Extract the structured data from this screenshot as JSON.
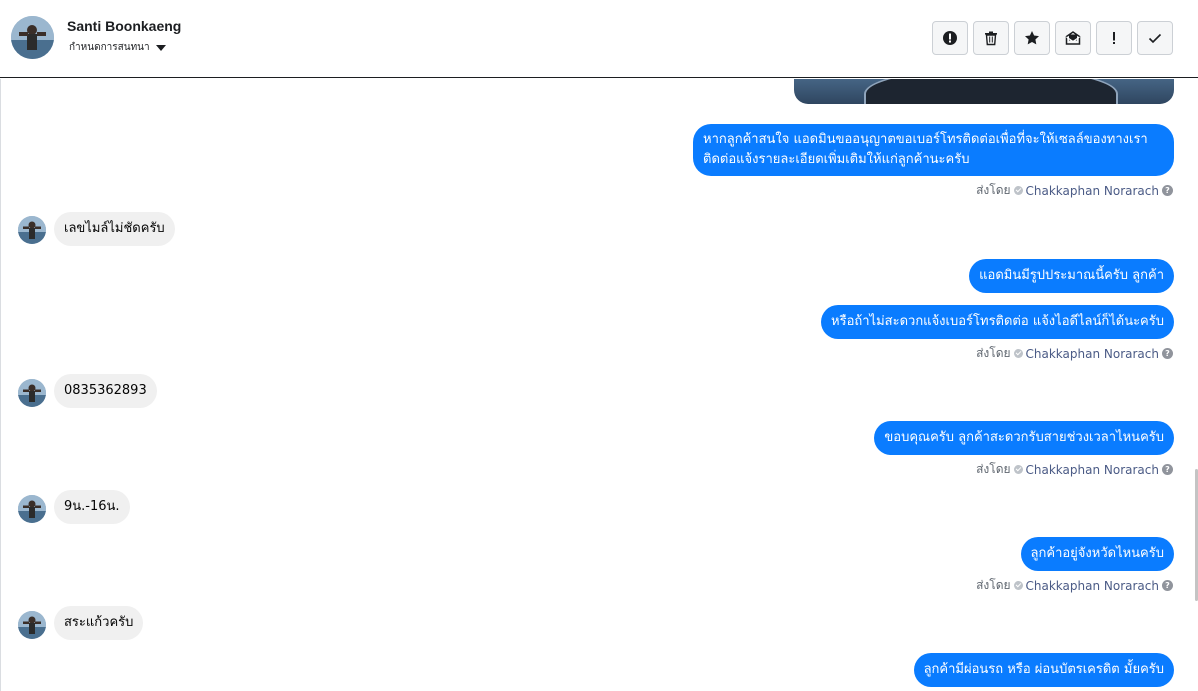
{
  "header": {
    "name": "Santi Boonkaeng",
    "subtitle": "กำหนดการสนทนา",
    "toolbar": [
      {
        "icon": "alert-circle-icon",
        "name": "spam-button"
      },
      {
        "icon": "trash-icon",
        "name": "delete-button"
      },
      {
        "icon": "star-icon",
        "name": "star-button"
      },
      {
        "icon": "mail-open-icon",
        "name": "mark-unread-button"
      },
      {
        "icon": "exclamation-icon",
        "name": "follow-up-button"
      },
      {
        "icon": "check-icon",
        "name": "done-button"
      }
    ]
  },
  "messages": [
    {
      "dir": "out",
      "text1": "หากลูกค้าสนใจ แอดมินขออนุญาตขอเบอร์โทรติดต่อเพื่อที่จะให้เซลล์ของทางเรา",
      "text2": "ติดต่อแจ้งรายละเอียดเพิ่มเติมให้แก่ลูกค้านะครับ"
    },
    {
      "dir": "in",
      "text": "เลขไมล์ไม่ชัดครับ"
    },
    {
      "dir": "out",
      "text": "แอดมินมีรูปประมาณนี้ครับ ลูกค้า"
    },
    {
      "dir": "out",
      "text": "หรือถ้าไม่สะดวกแจ้งเบอร์โทรติดต่อ แจ้งไอดีไลน์ก็ได้นะครับ"
    },
    {
      "dir": "in",
      "text": "0835362893"
    },
    {
      "dir": "out",
      "text": "ขอบคุณครับ ลูกค้าสะดวกรับสายช่วงเวลาไหนครับ"
    },
    {
      "dir": "in",
      "text": "9น.-16น."
    },
    {
      "dir": "out",
      "text": "ลูกค้าอยู่จังหวัดไหนครับ"
    },
    {
      "dir": "in",
      "text": "สระแก้วครับ"
    },
    {
      "dir": "out",
      "text": "ลูกค้ามีผ่อนรถ หรือ ผ่อนบัตรเครดิต มั้ยครับ"
    }
  ],
  "sent_by": {
    "label": "ส่งโดย",
    "agent": "Chakkaphan Norarach",
    "help": "?"
  }
}
